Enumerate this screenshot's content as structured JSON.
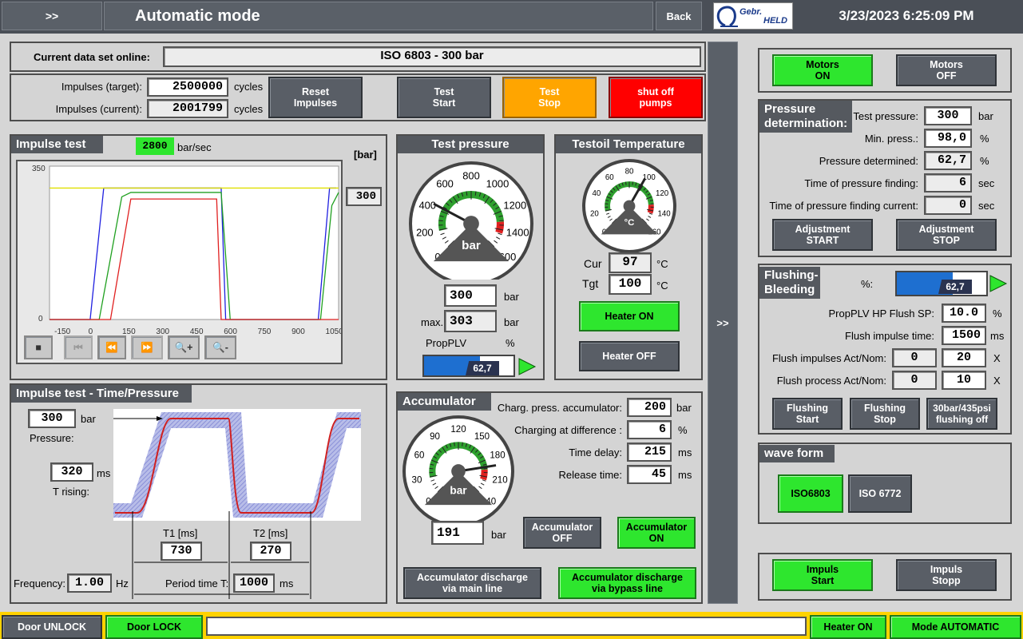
{
  "header": {
    "menu_label": ">>",
    "title": "Automatic mode",
    "back_label": "Back",
    "logo_text_1": "Gebr.",
    "logo_text_2": "HELD",
    "datetime": "3/23/2023 6:25:09 PM"
  },
  "dataset": {
    "label": "Current data set online:",
    "value": "ISO 6803 - 300 bar"
  },
  "impulses": {
    "target_label": "Impulses (target):",
    "target_value": "2500000",
    "target_unit": "cycles",
    "current_label": "Impulses (current):",
    "current_value": "2001799",
    "current_unit": "cycles",
    "reset_label_1": "Reset",
    "reset_label_2": "Impulses"
  },
  "test_buttons": {
    "start_1": "Test",
    "start_2": "Start",
    "stop_1": "Test",
    "stop_2": "Stop",
    "shutoff_1": "shut off",
    "shutoff_2": "pumps"
  },
  "impulse_test": {
    "title": "Impulse test",
    "rate_value": "2800",
    "rate_unit": "bar/sec",
    "unit_label": "[bar]",
    "setpoint": "300",
    "y_max": "350",
    "y_min": "0",
    "x_ticks": [
      "-150",
      "0",
      "150",
      "300",
      "450",
      "600",
      "750",
      "900",
      "1050"
    ]
  },
  "chart_data": {
    "type": "line",
    "ylim": [
      0,
      350
    ],
    "xlim": [
      -200,
      1080
    ],
    "series": [
      {
        "color": "#2020e0",
        "x": [
          -200,
          -20,
          40,
          560,
          580,
          620,
          990,
          1040,
          1070
        ],
        "y": [
          0,
          0,
          300,
          300,
          0,
          0,
          0,
          300,
          300
        ]
      },
      {
        "color": "#20a020",
        "x": [
          -200,
          20,
          120,
          160,
          560,
          600,
          660,
          1000,
          1050,
          1080
        ],
        "y": [
          0,
          0,
          280,
          290,
          290,
          0,
          0,
          0,
          260,
          290
        ]
      },
      {
        "color": "#e02020",
        "x": [
          -200,
          70,
          160,
          540,
          560,
          1080
        ],
        "y": [
          0,
          0,
          275,
          275,
          0,
          0
        ]
      },
      {
        "color": "#e0e000",
        "x": [
          -200,
          1080
        ],
        "y": [
          300,
          300
        ]
      }
    ]
  },
  "test_pressure": {
    "title": "Test pressure",
    "gauge_ticks": [
      "0",
      "200",
      "400",
      "600",
      "800",
      "1000",
      "1200",
      "1400",
      "1600"
    ],
    "gauge_unit": "bar",
    "gauge_value": 0.27,
    "value": "300",
    "value_unit": "bar",
    "max_label": "max.",
    "max_value": "303",
    "max_unit": "bar",
    "propplv_label": "PropPLV",
    "propplv_unit": "%",
    "propplv_value": "62,7",
    "propplv_fill": 0.627
  },
  "testoil": {
    "title": "Testoil Temperature",
    "gauge_ticks": [
      "0",
      "20",
      "40",
      "60",
      "80",
      "100",
      "120",
      "140",
      "160"
    ],
    "gauge_unit": "°C",
    "gauge_value": 0.61,
    "cur_label": "Cur",
    "cur_value": "97",
    "cur_unit": "°C",
    "tgt_label": "Tgt",
    "tgt_value": "100",
    "tgt_unit": "°C",
    "heater_on": "Heater ON",
    "heater_off": "Heater OFF"
  },
  "accumulator": {
    "title": "Accumulator",
    "gauge_ticks": [
      "0",
      "30",
      "60",
      "90",
      "120",
      "150",
      "180",
      "210",
      "240"
    ],
    "gauge_unit": "bar",
    "gauge_value": 0.8,
    "value": "191",
    "value_unit": "bar",
    "charg_label": "Charg. press. accumulator:",
    "charg_value": "200",
    "charg_unit": "bar",
    "diff_label": "Charging at difference :",
    "diff_value": "6",
    "diff_unit": "%",
    "delay_label": "Time delay:",
    "delay_value": "215",
    "delay_unit": "ms",
    "release_label": "Release time:",
    "release_value": "45",
    "release_unit": "ms",
    "off_1": "Accumulator",
    "off_2": "OFF",
    "on_1": "Accumulator",
    "on_2": "ON",
    "dis_main_1": "Accumulator discharge",
    "dis_main_2": "via main line",
    "dis_bypass_1": "Accumulator discharge",
    "dis_bypass_2": "via bypass line"
  },
  "time_pressure": {
    "title": "Impulse test - Time/Pressure",
    "pressure_value": "300",
    "pressure_unit": "bar",
    "pressure_label": "Pressure:",
    "rising_value": "320",
    "rising_unit": "ms",
    "rising_label": "T rising:",
    "t1_label": "T1 [ms]",
    "t1_value": "730",
    "t2_label": "T2 [ms]",
    "t2_value": "270",
    "freq_label": "Frequency:",
    "freq_value": "1.00",
    "freq_unit": "Hz",
    "period_label": "Period time T:",
    "period_value": "1000",
    "period_unit": "ms"
  },
  "side_toggle": ">>",
  "motors": {
    "on_1": "Motors",
    "on_2": "ON",
    "off_1": "Motors",
    "off_2": "OFF"
  },
  "pressure_det": {
    "title_1": "Pressure",
    "title_2": "determination:",
    "test_label": "Test pressure:",
    "test_value": "300",
    "test_unit": "bar",
    "min_label": "Min. press.:",
    "min_value": "98,0",
    "min_unit": "%",
    "det_label": "Pressure determined:",
    "det_value": "62,7",
    "det_unit": "%",
    "time_label": "Time of pressure finding:",
    "time_value": "6",
    "time_unit": "sec",
    "cur_label": "Time of pressure finding current:",
    "cur_value": "0",
    "cur_unit": "sec",
    "adj_start_1": "Adjustment",
    "adj_start_2": "START",
    "adj_stop_1": "Adjustment",
    "adj_stop_2": "STOP"
  },
  "flushing": {
    "title_1": "Flushing-",
    "title_2": "Bleeding",
    "pct_label": "%:",
    "pct_value": "62,7",
    "pct_fill": 0.627,
    "sp_label": "PropPLV HP Flush SP:",
    "sp_value": "10.0",
    "sp_unit": "%",
    "time_label": "Flush impulse time:",
    "time_value": "1500",
    "time_unit": "ms",
    "imp_label": "Flush impulses Act/Nom:",
    "imp_act": "0",
    "imp_nom": "20",
    "imp_unit": "X",
    "proc_label": "Flush process Act/Nom:",
    "proc_act": "0",
    "proc_nom": "10",
    "proc_unit": "X",
    "start_1": "Flushing",
    "start_2": "Start",
    "stop_1": "Flushing",
    "stop_2": "Stop",
    "off_1": "30bar/435psi",
    "off_2": "flushing off"
  },
  "waveform": {
    "title": "wave form",
    "iso6803": "ISO6803",
    "iso6772": "ISO 6772"
  },
  "impuls": {
    "start_1": "Impuls",
    "start_2": "Start",
    "stop_1": "Impuls",
    "stop_2": "Stopp"
  },
  "footer": {
    "door_unlock": "Door UNLOCK",
    "door_lock": "Door LOCK",
    "message": "",
    "heater_on": "Heater ON",
    "mode": "Mode AUTOMATIC"
  }
}
